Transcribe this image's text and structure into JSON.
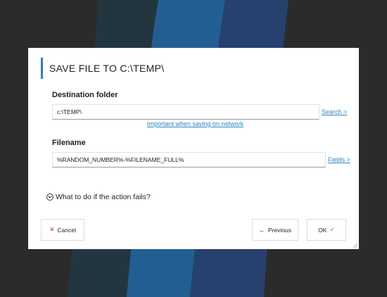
{
  "dialog": {
    "title": "SAVE FILE TO C:\\TEMP\\",
    "accent_color": "#2f7fb8"
  },
  "destination": {
    "label": "Destination folder",
    "value": "c:\\TEMP\\",
    "search_link": "Search >",
    "network_hint": "Important when saving on network"
  },
  "filename": {
    "label": "Filename",
    "value": "%RANDOM_NUMBER%-%FILENAME_FULL%",
    "fields_link": "Fields >"
  },
  "failure": {
    "label": "What to do if the action fails?",
    "icon": "chevron-down-icon"
  },
  "buttons": {
    "cancel_label": "Cancel",
    "cancel_icon": "close-icon",
    "previous_label": "Previous",
    "previous_icon": "arrow-left-icon",
    "ok_label": "OK",
    "ok_icon": "check-icon"
  },
  "colors": {
    "link": "#2b86c5",
    "cancel_x": "#d9342b",
    "ok_check": "#2fa0a0",
    "background": "#2b2b2b"
  }
}
